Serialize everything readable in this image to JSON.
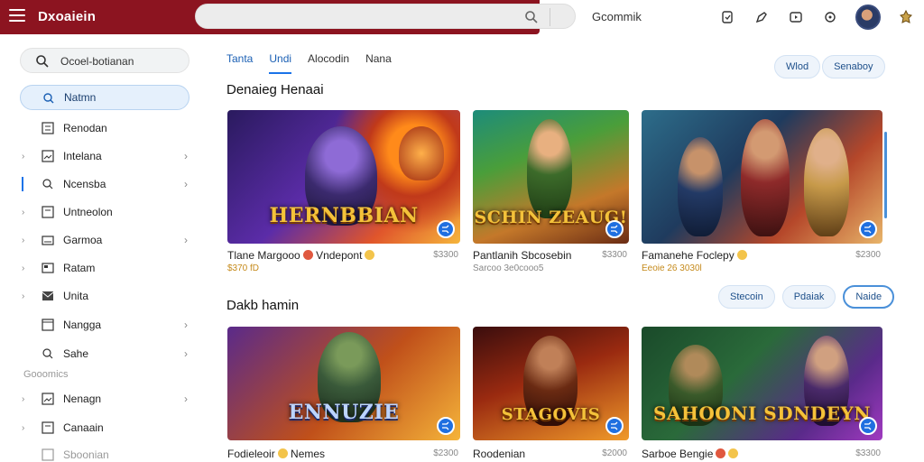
{
  "topbar": {
    "brand": "Dxoaiein",
    "account_label": "Gcommik",
    "icons": [
      "menu-icon",
      "search-icon",
      "library-icon",
      "edit-icon",
      "media-icon",
      "settings-icon",
      "avatar",
      "extension-icon"
    ]
  },
  "sidebar": {
    "search_text": "Ocoel-botianan",
    "items": [
      {
        "label": "Natmn",
        "icon": "home-icon",
        "active": true
      },
      {
        "label": "Renodan",
        "icon": "list-icon"
      },
      {
        "label": "Intelana",
        "icon": "image-icon"
      },
      {
        "label": "Ncensba",
        "icon": "search-icon"
      },
      {
        "label": "Untneolon",
        "icon": "doc-icon"
      },
      {
        "label": "Garmoa",
        "icon": "controller-icon"
      },
      {
        "label": "Ratam",
        "icon": "folder-icon"
      },
      {
        "label": "Unita",
        "icon": "mail-icon"
      },
      {
        "label": "Nangga",
        "icon": "window-icon"
      },
      {
        "label": "Sahe",
        "icon": "tag-icon"
      }
    ],
    "section_label": "Gooomics",
    "section_items": [
      {
        "label": "Nenagn",
        "icon": "image-icon"
      },
      {
        "label": "Canaain",
        "icon": "doc-icon"
      },
      {
        "label": "Sboonian",
        "icon": "grid-icon"
      }
    ]
  },
  "main": {
    "tabs": [
      "Tanta",
      "Undi",
      "Alocodin",
      "Nana"
    ],
    "top_pills": [
      "Wlod",
      "Senaboy"
    ],
    "section1_title": "Denaieg Henaai",
    "section2_title": "Dakb hamin",
    "section2_pills": [
      "Stecoin",
      "Pdaiak",
      "Naide"
    ],
    "row1": [
      {
        "art": "HERNBBIAN",
        "title": "Tlane Margooo",
        "extra": "Vndepont",
        "sub": "$370 fD",
        "price": "$3300"
      },
      {
        "art": "SCHIN ZEAUG!",
        "title": "Pantlanih Sbcosebin",
        "extra": "",
        "sub": "Sarcoo 3e0cooo5",
        "price": "$3300"
      },
      {
        "art": "",
        "title": "Famanehe Foclepy",
        "extra": "",
        "sub": "Eeoie 26 3030l",
        "price": "$2300"
      }
    ],
    "row2": [
      {
        "art": "ENNUZIE",
        "title": "Fodieleoir",
        "extra": "Nemes",
        "sub": "",
        "price": "$2300"
      },
      {
        "art": "STAGOVIS",
        "title": "Roodenian",
        "extra": "",
        "sub": "",
        "price": "$2000"
      },
      {
        "art": "SAHOONI SDNDEYN",
        "title": "Sarboe Bengie",
        "extra": "",
        "sub": "",
        "price": "$3300"
      }
    ],
    "badge_icon": "shuffle-icon"
  },
  "colors": {
    "brand": "#8c1420",
    "accent": "#1a73e8",
    "price": "#888888"
  }
}
